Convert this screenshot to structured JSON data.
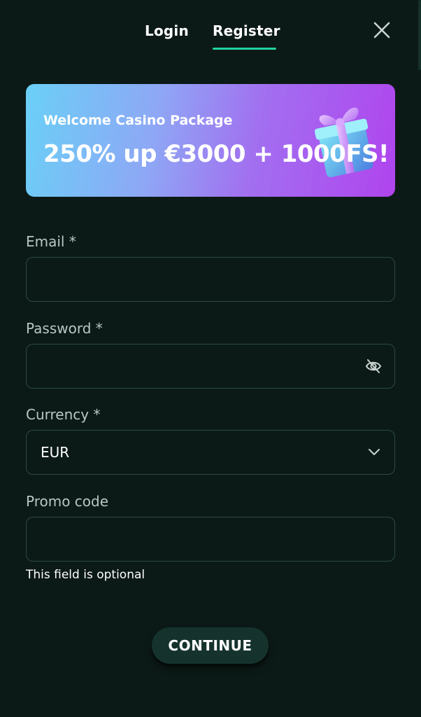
{
  "header": {
    "tabs": [
      {
        "label": "Login",
        "active": false
      },
      {
        "label": "Register",
        "active": true
      }
    ],
    "accent_color": "#22d3a0",
    "close_icon": "close-icon"
  },
  "banner": {
    "subtitle": "Welcome Casino Package",
    "title": "250% up €3000 + 1000FS!",
    "image": "gift-box-icon"
  },
  "form": {
    "email": {
      "label": "Email *",
      "value": "",
      "placeholder": ""
    },
    "password": {
      "label": "Password *",
      "value": "",
      "placeholder": "",
      "toggle_icon": "eye-off-icon"
    },
    "currency": {
      "label": "Currency *",
      "value": "EUR",
      "icon": "chevron-down-icon"
    },
    "promo": {
      "label": "Promo code",
      "value": "",
      "placeholder": "",
      "hint": "This field is optional"
    }
  },
  "actions": {
    "continue_label": "CONTINUE"
  }
}
